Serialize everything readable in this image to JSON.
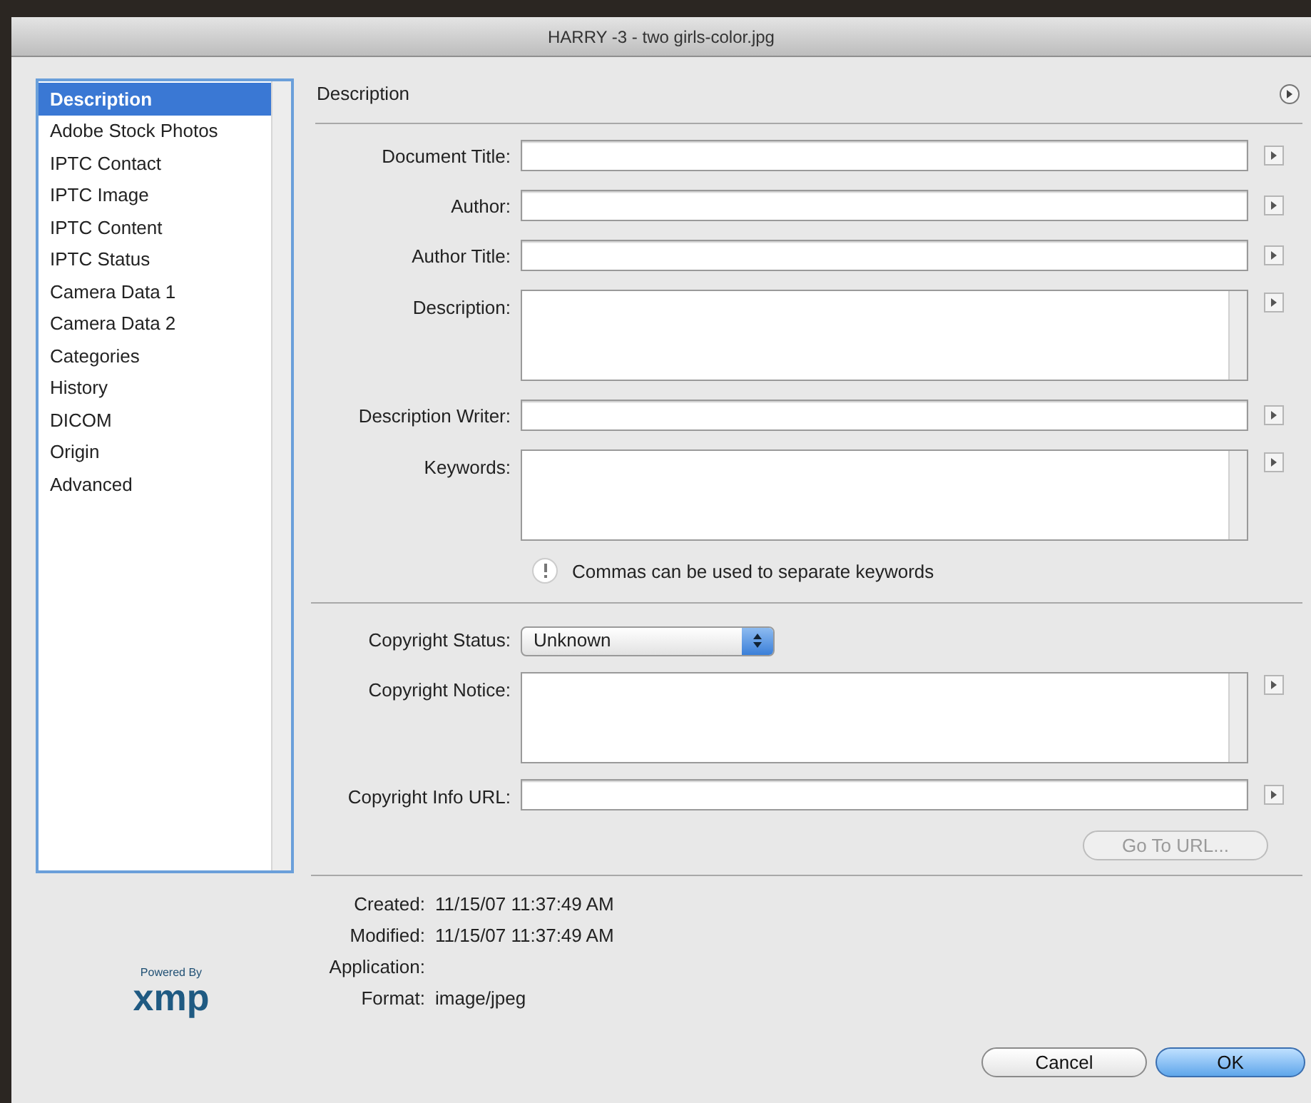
{
  "window": {
    "title": "HARRY -3 - two girls-color.jpg"
  },
  "sidebar": {
    "items": [
      {
        "label": "Description",
        "selected": true
      },
      {
        "label": "Adobe Stock Photos",
        "selected": false
      },
      {
        "label": "IPTC Contact",
        "selected": false
      },
      {
        "label": "IPTC Image",
        "selected": false
      },
      {
        "label": "IPTC Content",
        "selected": false
      },
      {
        "label": "IPTC Status",
        "selected": false
      },
      {
        "label": "Camera Data 1",
        "selected": false
      },
      {
        "label": "Camera Data 2",
        "selected": false
      },
      {
        "label": "Categories",
        "selected": false
      },
      {
        "label": "History",
        "selected": false
      },
      {
        "label": "DICOM",
        "selected": false
      },
      {
        "label": "Origin",
        "selected": false
      },
      {
        "label": "Advanced",
        "selected": false
      }
    ]
  },
  "panel": {
    "title": "Description"
  },
  "fields": [
    {
      "label": "Document Title:",
      "kind": "text"
    },
    {
      "label": "Author:",
      "kind": "text"
    },
    {
      "label": "Author Title:",
      "kind": "text"
    },
    {
      "label": "Description:",
      "kind": "area"
    },
    {
      "label": "Description Writer:",
      "kind": "text"
    },
    {
      "label": "Keywords:",
      "kind": "area"
    }
  ],
  "hint": "Commas can be used to separate keywords",
  "copyright_status": {
    "label": "Copyright Status:",
    "value": "Unknown"
  },
  "copyright_fields": [
    {
      "label": "Copyright Notice:",
      "kind": "area"
    },
    {
      "label": "Copyright Info URL:",
      "kind": "text"
    }
  ],
  "go_to_url": {
    "label": "Go To URL...",
    "disabled": true
  },
  "info": [
    {
      "label": "Created:",
      "value": "11/15/07 11:37:49 AM"
    },
    {
      "label": "Modified:",
      "value": "11/15/07 11:37:49 AM"
    },
    {
      "label": "Application:"
    },
    {
      "label": "Format:",
      "value": "image/jpeg"
    }
  ],
  "logo": {
    "caption": "Powered By",
    "wordmark": "xmp"
  },
  "buttons": [
    {
      "label": "Cancel",
      "default": false
    },
    {
      "label": "OK",
      "default": true
    }
  ]
}
